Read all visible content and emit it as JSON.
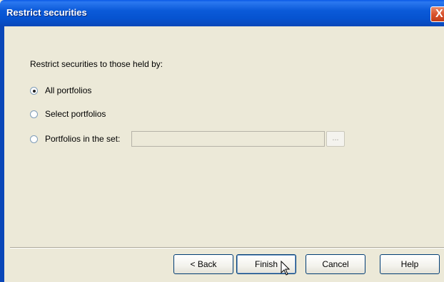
{
  "window": {
    "title": "Restrict securities",
    "close_glyph": "X"
  },
  "prompt": "Restrict securities to those held by:",
  "options": [
    {
      "label": "All portfolios",
      "checked": true
    },
    {
      "label": "Select portfolios",
      "checked": false
    },
    {
      "label": "Portfolios in the set:",
      "checked": false
    }
  ],
  "set_field": {
    "value": ""
  },
  "browse_label": "...",
  "buttons": {
    "back": "< Back",
    "finish": "Finish",
    "cancel": "Cancel",
    "help": "Help"
  },
  "colors": {
    "titlebar": "#0653d0",
    "background": "#ece9d8",
    "close": "#d9532e"
  }
}
